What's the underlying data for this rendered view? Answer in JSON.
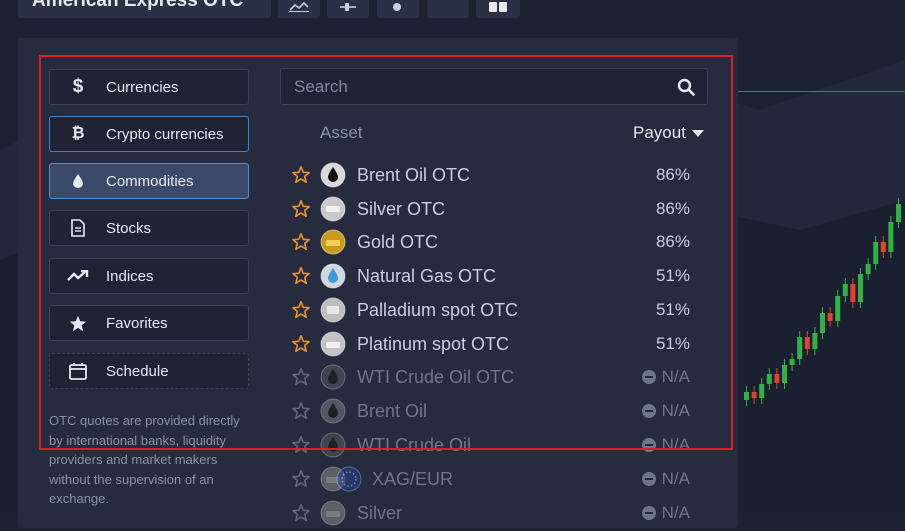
{
  "topbar": {
    "asset_title": "American Express OTC"
  },
  "categories": [
    {
      "label": "Currencies",
      "icon": "dollar-icon"
    },
    {
      "label": "Crypto currencies",
      "icon": "bitcoin-icon"
    },
    {
      "label": "Commodities",
      "icon": "drop-icon"
    },
    {
      "label": "Stocks",
      "icon": "document-icon"
    },
    {
      "label": "Indices",
      "icon": "trend-icon"
    },
    {
      "label": "Favorites",
      "icon": "star-icon"
    },
    {
      "label": "Schedule",
      "icon": "calendar-icon"
    }
  ],
  "note": "OTC quotes are provided directly by international banks, liquidity providers and market makers without the supervision of an exchange.",
  "search": {
    "placeholder": "Search"
  },
  "columns": {
    "asset": "Asset",
    "payout": "Payout"
  },
  "assets": [
    {
      "name": "Brent Oil OTC",
      "payout": "86%"
    },
    {
      "name": "Silver OTC",
      "payout": "86%"
    },
    {
      "name": "Gold OTC",
      "payout": "86%"
    },
    {
      "name": "Natural Gas OTC",
      "payout": "51%"
    },
    {
      "name": "Palladium spot OTC",
      "payout": "51%"
    },
    {
      "name": "Platinum spot OTC",
      "payout": "51%"
    },
    {
      "name": "WTI Crude Oil OTC",
      "payout": "N/A"
    },
    {
      "name": "Brent Oil",
      "payout": "N/A"
    },
    {
      "name": "WTI Crude Oil",
      "payout": "N/A"
    },
    {
      "name": "XAG/EUR",
      "payout": "N/A"
    },
    {
      "name": "Silver",
      "payout": "N/A"
    }
  ],
  "colors": {
    "accent": "#3d82c9",
    "highlight": "#e11d1d",
    "star": "#e8912d",
    "candle_up": "#2fb344",
    "candle_down": "#e5402f"
  }
}
